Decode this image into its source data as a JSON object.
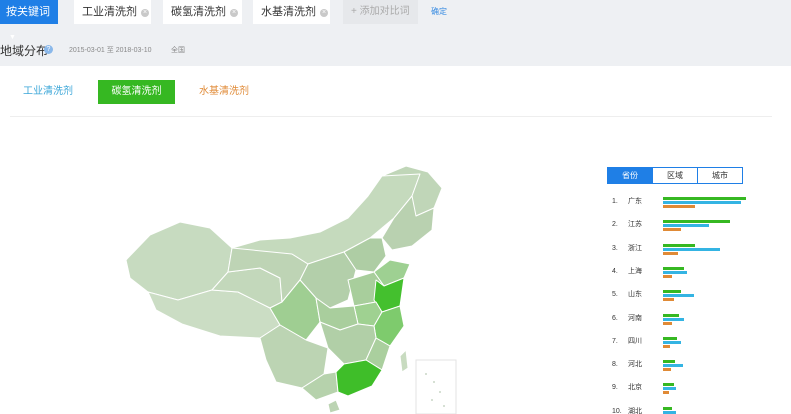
{
  "topbar": {
    "select_label": "按关键词",
    "keywords": [
      "工业清洗剂",
      "碳氢清洗剂",
      "水基清洗剂"
    ],
    "add_compare": "+ 添加对比词",
    "confirm": "确定"
  },
  "section": {
    "title": "地域分布",
    "help": "?",
    "date_start": "2015-03-01",
    "date_sep": "至",
    "date_end": "2018-03-10",
    "scope": "全国"
  },
  "compare_tabs": [
    "工业清洗剂",
    "碳氢清洗剂",
    "水基清洗剂"
  ],
  "colors": {
    "keyword1": "#34b4e3",
    "keyword2": "#36b822",
    "keyword3": "#e08a36",
    "accent": "#1f7fe6"
  },
  "ranking": {
    "tabs": [
      "省份",
      "区域",
      "城市"
    ],
    "active_tab": "省份",
    "rows": [
      {
        "rank": "1.",
        "name": "广东",
        "v2": 0.9,
        "v1": 0.85,
        "v3": 0.35
      },
      {
        "rank": "2.",
        "name": "江苏",
        "v2": 0.73,
        "v1": 0.5,
        "v3": 0.2
      },
      {
        "rank": "3.",
        "name": "浙江",
        "v2": 0.35,
        "v1": 0.62,
        "v3": 0.16
      },
      {
        "rank": "4.",
        "name": "上海",
        "v2": 0.23,
        "v1": 0.26,
        "v3": 0.1
      },
      {
        "rank": "5.",
        "name": "山东",
        "v2": 0.2,
        "v1": 0.34,
        "v3": 0.12
      },
      {
        "rank": "6.",
        "name": "河南",
        "v2": 0.17,
        "v1": 0.23,
        "v3": 0.1
      },
      {
        "rank": "7.",
        "name": "四川",
        "v2": 0.15,
        "v1": 0.2,
        "v3": 0.08
      },
      {
        "rank": "8.",
        "name": "河北",
        "v2": 0.13,
        "v1": 0.22,
        "v3": 0.09
      },
      {
        "rank": "9.",
        "name": "北京",
        "v2": 0.12,
        "v1": 0.14,
        "v3": 0.06
      },
      {
        "rank": "10.",
        "name": "湖北",
        "v2": 0.1,
        "v1": 0.14,
        "v3": 0.05
      }
    ]
  }
}
